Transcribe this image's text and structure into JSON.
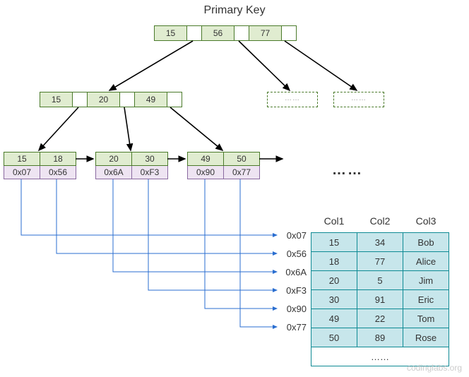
{
  "title": "Primary Key",
  "root": {
    "k1": "15",
    "k2": "56",
    "k3": "77"
  },
  "internal": {
    "k1": "15",
    "k2": "20",
    "k3": "49"
  },
  "dashed_text": "……",
  "leaves": [
    {
      "k1": "15",
      "k2": "18",
      "p1": "0x07",
      "p2": "0x56"
    },
    {
      "k1": "20",
      "k2": "30",
      "p1": "0x6A",
      "p2": "0xF3"
    },
    {
      "k1": "49",
      "k2": "50",
      "p1": "0x90",
      "p2": "0x77"
    }
  ],
  "leaf_ellipsis": "……",
  "table": {
    "headers": {
      "c1": "Col1",
      "c2": "Col2",
      "c3": "Col3"
    },
    "rows": [
      {
        "addr": "0x07",
        "c1": "15",
        "c2": "34",
        "c3": "Bob"
      },
      {
        "addr": "0x56",
        "c1": "18",
        "c2": "77",
        "c3": "Alice"
      },
      {
        "addr": "0x6A",
        "c1": "20",
        "c2": "5",
        "c3": "Jim"
      },
      {
        "addr": "0xF3",
        "c1": "30",
        "c2": "91",
        "c3": "Eric"
      },
      {
        "addr": "0x90",
        "c1": "49",
        "c2": "22",
        "c3": "Tom"
      },
      {
        "addr": "0x77",
        "c1": "50",
        "c2": "89",
        "c3": "Rose"
      }
    ],
    "more": "……"
  },
  "watermark": "codinglabs.org"
}
